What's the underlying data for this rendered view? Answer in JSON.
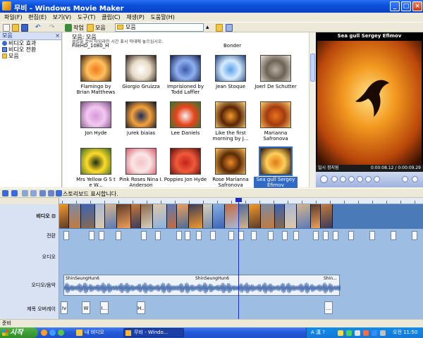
{
  "window": {
    "title": "무비 - Windows Movie Maker"
  },
  "menu": [
    "파일(F)",
    "편집(E)",
    "보기(V)",
    "도구(T)",
    "클립(C)",
    "재생(P)",
    "도움말(H)"
  ],
  "toolbar": {
    "tasks_label": "작업",
    "collections_label": "모음",
    "location_value": "모음"
  },
  "tree": {
    "header": "모음",
    "items": [
      "비디오 효과",
      "비디오 전환",
      "모음"
    ]
  },
  "content": {
    "caption1": "모음: 모음",
    "caption2": "클립을 끌어 타임라인 시간 표시 막대에 놓으십시오.",
    "top_labels": [
      "FileHD_1080_H",
      "Bonder"
    ],
    "clips": [
      {
        "label": "Flamingo by Brian Matthews",
        "colors": [
          "#f07a1c",
          "#ffc15e",
          "#3d1a07"
        ]
      },
      {
        "label": "Giorgio Gruizza",
        "colors": [
          "#ffffff",
          "#e8dcc8",
          "#2c1a0e"
        ]
      },
      {
        "label": "Imprisioned by Todd Laffler",
        "colors": [
          "#3a5aa8",
          "#8fb0f0",
          "#0c1a4a"
        ]
      },
      {
        "label": "Jean Stoque",
        "colors": [
          "#5aa0e8",
          "#d6ecff",
          "#1a3e7a"
        ]
      },
      {
        "label": "Joerl De Schutter",
        "colors": [
          "#b8b0a2",
          "#6c6356",
          "#e9e2d4"
        ]
      },
      {
        "label": "Jon Hyde",
        "colors": [
          "#d79ad8",
          "#f3c8f0",
          "#7a4d82"
        ]
      },
      {
        "label": "jurek biaias",
        "colors": [
          "#1e2c5e",
          "#f4a23a",
          "#0a0f24"
        ]
      },
      {
        "label": "Lee Daniels",
        "colors": [
          "#f3f3f3",
          "#e8441c",
          "#2a7a2a"
        ]
      },
      {
        "label": "Like the first morning by J...",
        "colors": [
          "#f59a2a",
          "#5a2506",
          "#ffd57a"
        ]
      },
      {
        "label": "Marianna Safronova",
        "colors": [
          "#e9741a",
          "#a23a10",
          "#ffcf6a"
        ]
      },
      {
        "label": "Mrs Yellow G S t e W...",
        "colors": [
          "#1a2c14",
          "#ffdc2a",
          "#3a6a22"
        ]
      },
      {
        "label": "Pink Roses Nina I. Anderson",
        "colors": [
          "#f5c3c8",
          "#fae6e6",
          "#d65a6a"
        ]
      },
      {
        "label": "Poppies Jon Hyde",
        "colors": [
          "#c42218",
          "#ef5a3a",
          "#5a0c08"
        ]
      },
      {
        "label": "Rose Marianna Safronova",
        "colors": [
          "#ee8a2a",
          "#5a2a06",
          "#ffc25a"
        ]
      },
      {
        "label": "Sea gull Sergey Efimov",
        "colors": [
          "#e07a14",
          "#ffcf5a",
          "#2a1004"
        ]
      }
    ]
  },
  "preview": {
    "title": "Sea gull Sergey Efimov",
    "status": "일시 정지됨",
    "time": "0:00:08.12 / 0:00:09.29"
  },
  "timeline": {
    "storyboard_label": "스토리보드 표시합니다.",
    "tracks": {
      "video": "비디오",
      "transition": "전환",
      "audio": "오디오",
      "audio_music": "오디오/음악",
      "title_overlay": "제목 오버레이"
    },
    "audio_clip_labels": [
      "ShinSeungHun6",
      "ShinSeungHun6",
      "Shin..."
    ],
    "title_clips": [
      "Iv",
      "W",
      "I...",
      "H...",
      "..."
    ]
  },
  "statusbar": {
    "text": "준비"
  },
  "taskbar": {
    "start": "시작",
    "quick_item": "내 비디오",
    "task": "무비 - Windo...",
    "language": "A 漢 ?",
    "clock": "오전 11:50"
  }
}
